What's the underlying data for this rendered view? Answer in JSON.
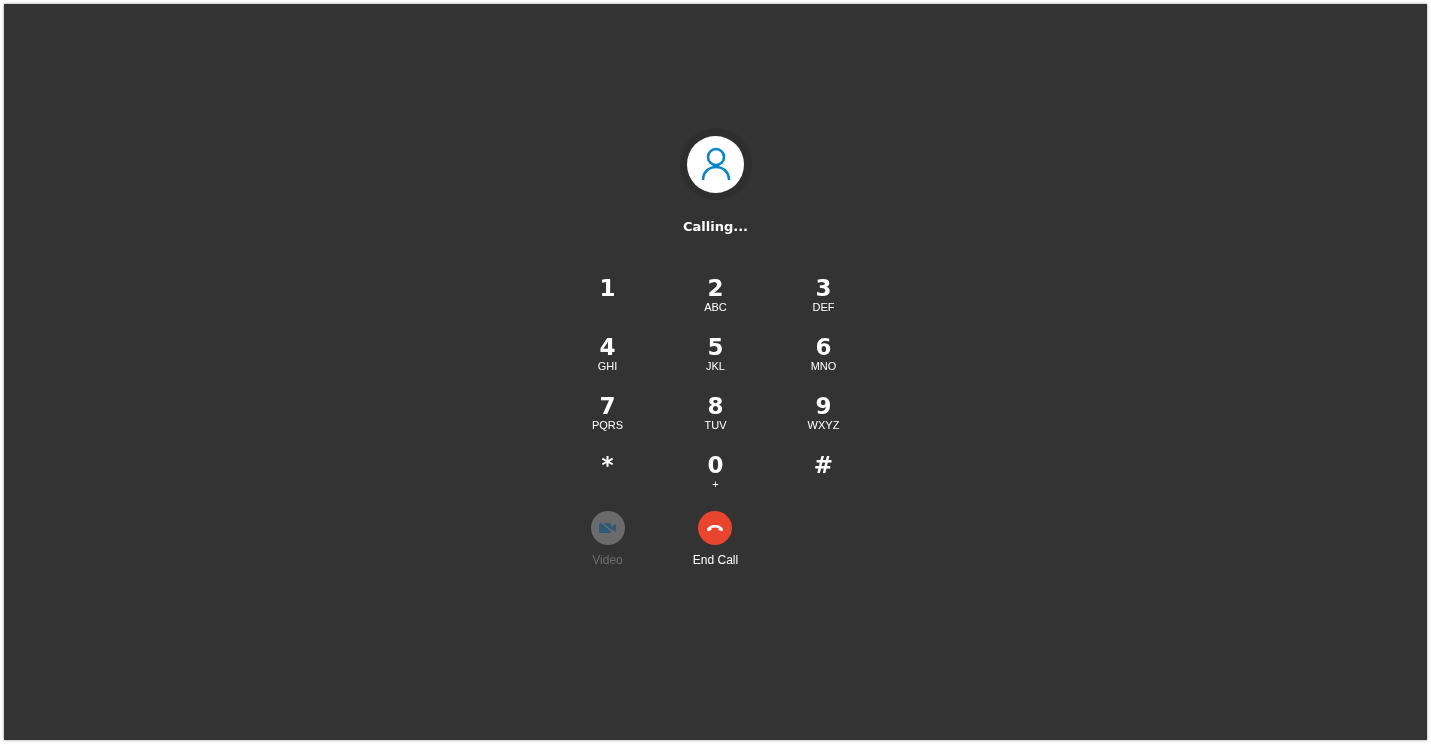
{
  "status": "Calling...",
  "keypad": [
    {
      "digit": "1"
    },
    {
      "digit": "2",
      "letters": "ABC"
    },
    {
      "digit": "3",
      "letters": "DEF"
    },
    {
      "digit": "4",
      "letters": "GHI"
    },
    {
      "digit": "5",
      "letters": "JKL"
    },
    {
      "digit": "6",
      "letters": "MNO"
    },
    {
      "digit": "7",
      "letters": "PQRS"
    },
    {
      "digit": "8",
      "letters": "TUV"
    },
    {
      "digit": "9",
      "letters": "WXYZ"
    },
    {
      "digit": "*"
    },
    {
      "digit": "0",
      "letters": "+"
    },
    {
      "digit": "#"
    }
  ],
  "actions": [
    {
      "kind": "video",
      "label": "Video",
      "disabled": true
    },
    {
      "kind": "end_call",
      "label": "End Call",
      "disabled": false
    }
  ]
}
